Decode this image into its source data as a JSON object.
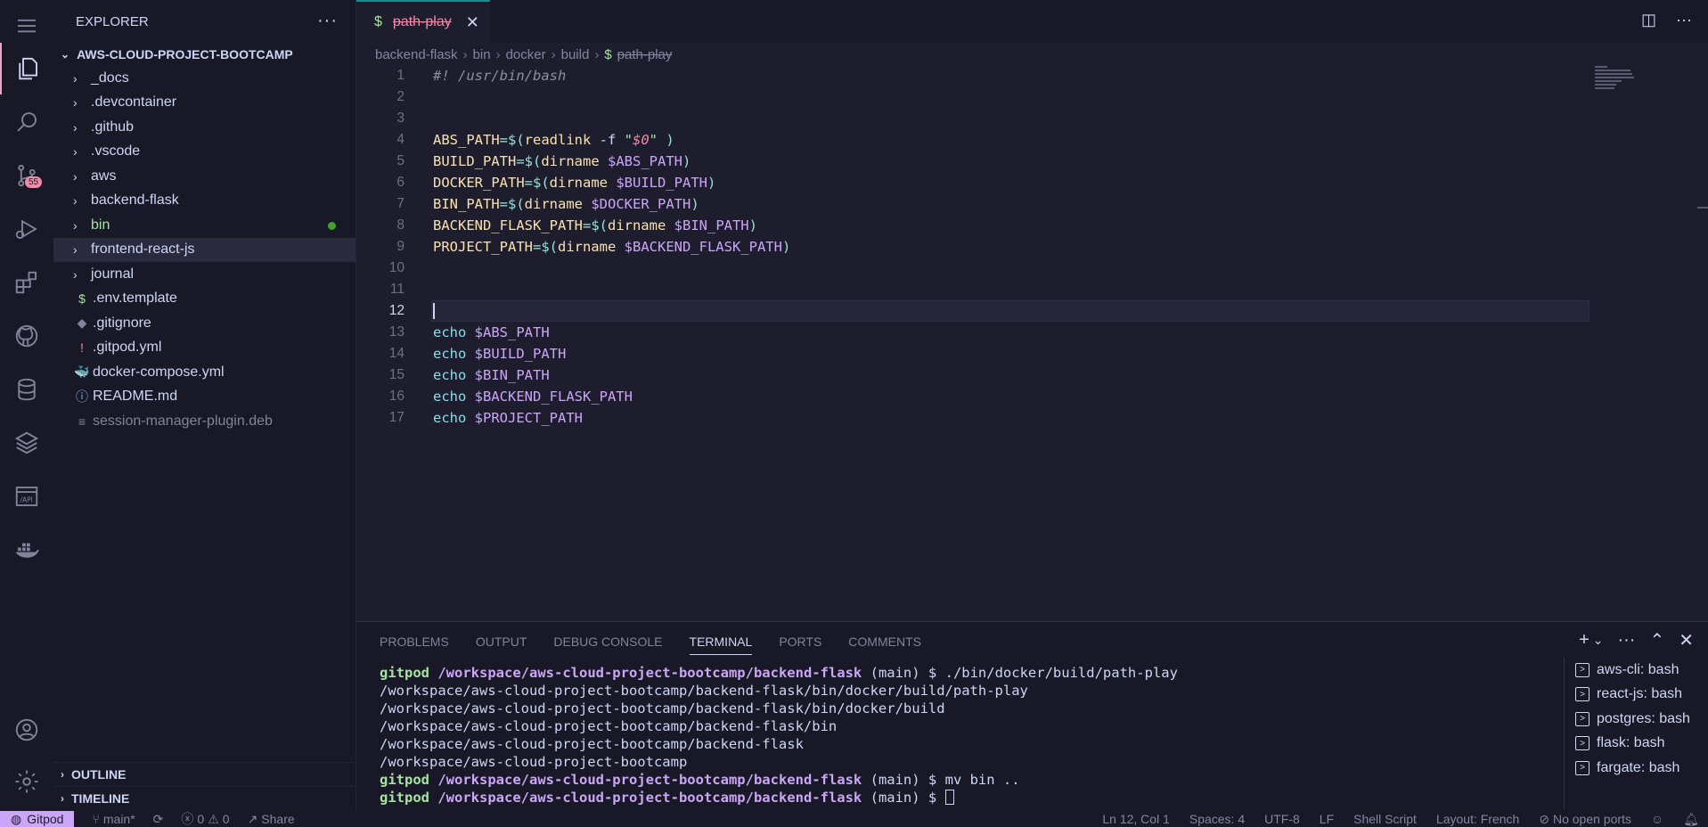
{
  "sidebar": {
    "title": "EXPLORER",
    "project": "AWS-CLOUD-PROJECT-BOOTCAMP",
    "items": [
      {
        "label": "_docs",
        "type": "folder",
        "color": "#cdd6f4"
      },
      {
        "label": ".devcontainer",
        "type": "folder",
        "color": "#cdd6f4"
      },
      {
        "label": ".github",
        "type": "folder",
        "color": "#cdd6f4"
      },
      {
        "label": ".vscode",
        "type": "folder",
        "color": "#cdd6f4"
      },
      {
        "label": "aws",
        "type": "folder",
        "color": "#cdd6f4"
      },
      {
        "label": "backend-flask",
        "type": "folder",
        "color": "#cdd6f4"
      },
      {
        "label": "bin",
        "type": "folder",
        "color": "#a6e3a1"
      },
      {
        "label": "frontend-react-js",
        "type": "folder",
        "color": "#cdd6f4"
      },
      {
        "label": "journal",
        "type": "folder",
        "color": "#cdd6f4"
      },
      {
        "label": ".env.template",
        "type": "file",
        "icon": "$",
        "color": "#cdd6f4"
      },
      {
        "label": ".gitignore",
        "type": "file",
        "icon": "◆",
        "color": "#cdd6f4"
      },
      {
        "label": ".gitpod.yml",
        "type": "file",
        "icon": "!",
        "color": "#cdd6f4"
      },
      {
        "label": "docker-compose.yml",
        "type": "file",
        "icon": "🐳",
        "color": "#cdd6f4"
      },
      {
        "label": "README.md",
        "type": "file",
        "icon": "ⓘ",
        "color": "#cdd6f4"
      },
      {
        "label": "session-manager-plugin.deb",
        "type": "file",
        "icon": "≡",
        "color": "#7f849c"
      }
    ],
    "outline": "OUTLINE",
    "timeline": "TIMELINE",
    "scm_badge": "55"
  },
  "tab": {
    "icon": "$",
    "name": "path-play"
  },
  "breadcrumb": [
    "backend-flask",
    "bin",
    "docker",
    "build",
    "path-play"
  ],
  "editor": {
    "line_numbers": [
      "1",
      "2",
      "3",
      "4",
      "5",
      "6",
      "7",
      "8",
      "9",
      "10",
      "11",
      "12",
      "13",
      "14",
      "15",
      "16",
      "17"
    ],
    "current_line": "12"
  },
  "panel": {
    "tabs": [
      "PROBLEMS",
      "OUTPUT",
      "DEBUG CONSOLE",
      "TERMINAL",
      "PORTS",
      "COMMENTS"
    ],
    "active_tab": "TERMINAL",
    "terminal_user": "gitpod",
    "terminal_cwd": "/workspace/aws-cloud-project-bootcamp/backend-flask",
    "terminal_branch": "(main) $",
    "cmd1": "./bin/docker/build/path-play",
    "output": [
      "/workspace/aws-cloud-project-bootcamp/backend-flask/bin/docker/build/path-play",
      "/workspace/aws-cloud-project-bootcamp/backend-flask/bin/docker/build",
      "/workspace/aws-cloud-project-bootcamp/backend-flask/bin",
      "/workspace/aws-cloud-project-bootcamp/backend-flask",
      "/workspace/aws-cloud-project-bootcamp"
    ],
    "cmd2": "mv bin ..",
    "terminals": [
      "aws-cli: bash",
      "react-js: bash",
      "postgres: bash",
      "flask: bash",
      "fargate: bash"
    ]
  },
  "status": {
    "gitpod": "Gitpod",
    "branch": "main*",
    "errors": "0",
    "warnings": "0",
    "share": "Share",
    "position": "Ln 12, Col 1",
    "spaces": "Spaces: 4",
    "encoding": "UTF-8",
    "eol": "LF",
    "language": "Shell Script",
    "layout": "Layout: French",
    "ports": "No open ports"
  },
  "colors": {
    "accent": "#cba6f7",
    "green": "#a6e3a1",
    "teal": "#1f8a8a",
    "red": "#f38ba8"
  }
}
